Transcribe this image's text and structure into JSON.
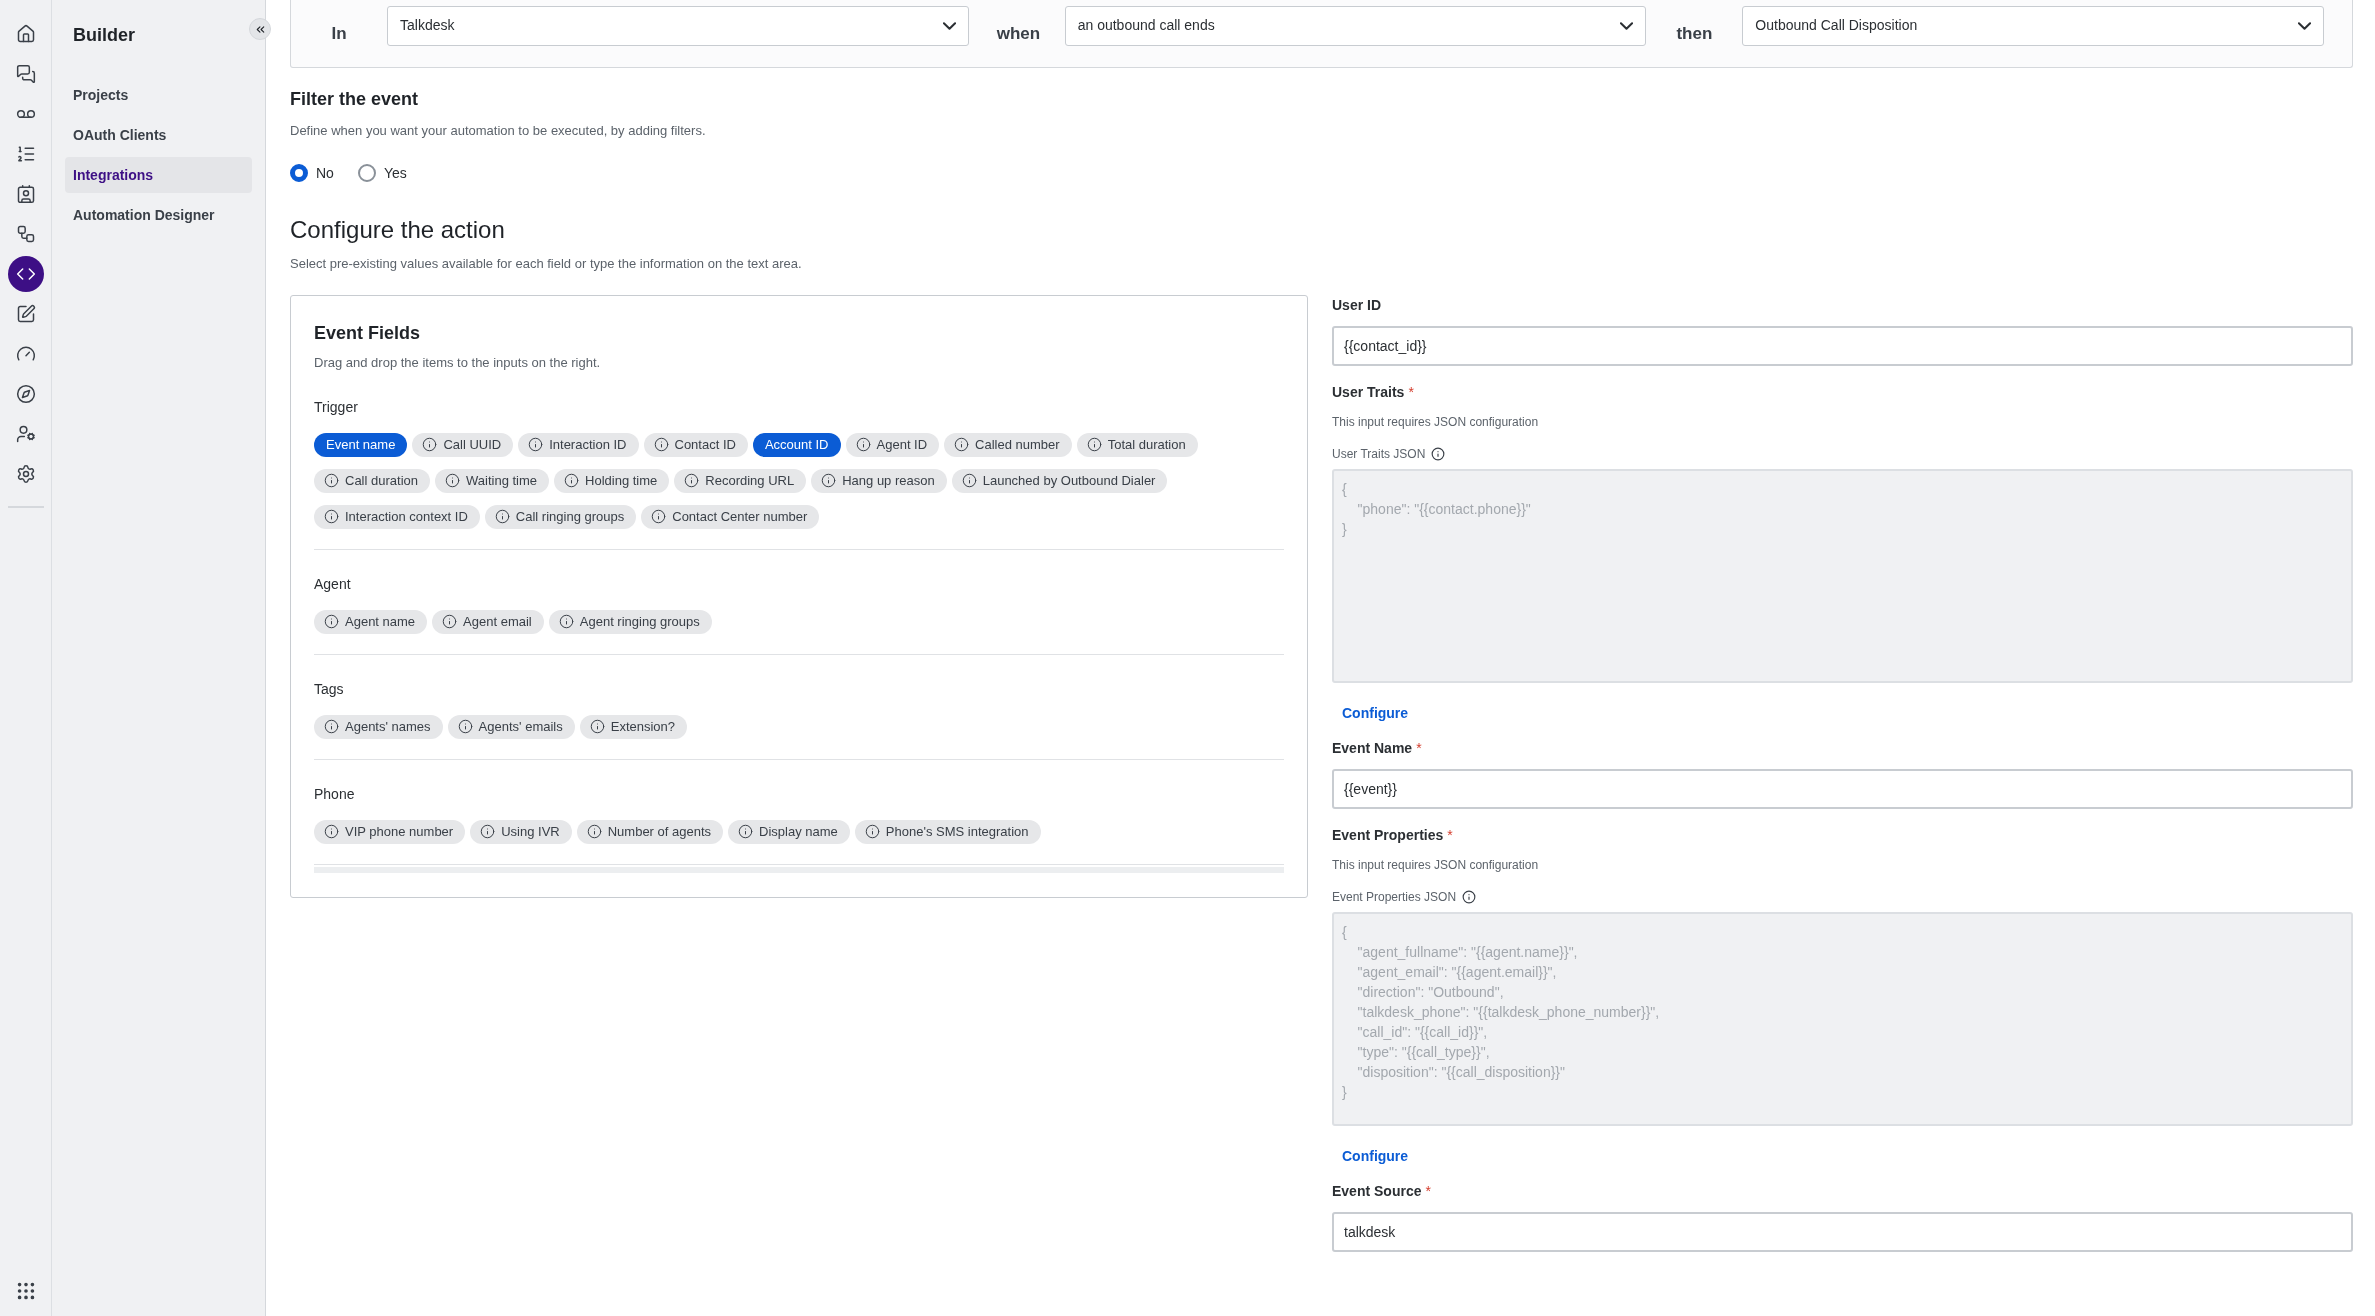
{
  "rail": {
    "items": [
      {
        "selected": false
      },
      {
        "selected": false
      },
      {
        "selected": false
      },
      {
        "selected": false
      },
      {
        "selected": false
      },
      {
        "selected": false
      },
      {
        "selected": true
      },
      {
        "selected": false
      },
      {
        "selected": false
      },
      {
        "selected": false
      },
      {
        "selected": false
      },
      {
        "selected": false
      }
    ]
  },
  "sidebar": {
    "title": "Builder",
    "items": [
      {
        "label": "Projects",
        "selected": false
      },
      {
        "label": "OAuth Clients",
        "selected": false
      },
      {
        "label": "Integrations",
        "selected": true
      },
      {
        "label": "Automation Designer",
        "selected": false
      }
    ]
  },
  "trigger_bar": {
    "parts": [
      {
        "label": "In",
        "value": "Talkdesk"
      },
      {
        "label": "when",
        "value": "an outbound call ends"
      },
      {
        "label": "then",
        "value": "Outbound Call Disposition"
      }
    ]
  },
  "filter": {
    "title": "Filter the event",
    "description": "Define when you want your automation to be executed, by adding filters.",
    "options": [
      {
        "label": "No",
        "selected": true
      },
      {
        "label": "Yes",
        "selected": false
      }
    ]
  },
  "configure": {
    "title": "Configure the action",
    "description": "Select pre-existing values available for each field or type the information on the text area."
  },
  "event_fields": {
    "title": "Event Fields",
    "description": "Drag and drop the items to the inputs on the right.",
    "groups": [
      {
        "title": "Trigger",
        "chips": [
          {
            "label": "Event name",
            "selected": true
          },
          {
            "label": "Call UUID",
            "selected": false
          },
          {
            "label": "Interaction ID",
            "selected": false
          },
          {
            "label": "Contact ID",
            "selected": false
          },
          {
            "label": "Account ID",
            "selected": true
          },
          {
            "label": "Agent ID",
            "selected": false
          },
          {
            "label": "Called number",
            "selected": false
          },
          {
            "label": "Total duration",
            "selected": false
          },
          {
            "label": "Call duration",
            "selected": false
          },
          {
            "label": "Waiting time",
            "selected": false
          },
          {
            "label": "Holding time",
            "selected": false
          },
          {
            "label": "Recording URL",
            "selected": false
          },
          {
            "label": "Hang up reason",
            "selected": false
          },
          {
            "label": "Launched by Outbound Dialer",
            "selected": false
          },
          {
            "label": "Interaction context ID",
            "selected": false
          },
          {
            "label": "Call ringing groups",
            "selected": false
          },
          {
            "label": "Contact Center number",
            "selected": false
          }
        ]
      },
      {
        "title": "Agent",
        "chips": [
          {
            "label": "Agent name",
            "selected": false
          },
          {
            "label": "Agent email",
            "selected": false
          },
          {
            "label": "Agent ringing groups",
            "selected": false
          }
        ]
      },
      {
        "title": "Tags",
        "chips": [
          {
            "label": "Agents' names",
            "selected": false
          },
          {
            "label": "Agents' emails",
            "selected": false
          },
          {
            "label": "Extension?",
            "selected": false
          }
        ]
      },
      {
        "title": "Phone",
        "chips": [
          {
            "label": "VIP phone number",
            "selected": false
          },
          {
            "label": "Using IVR",
            "selected": false
          },
          {
            "label": "Number of agents",
            "selected": false
          },
          {
            "label": "Display name",
            "selected": false
          },
          {
            "label": "Phone's SMS integration",
            "selected": false
          }
        ]
      }
    ]
  },
  "fields": [
    {
      "kind": "input",
      "label": "User ID",
      "value": "{{contact_id}}"
    },
    {
      "kind": "json",
      "label": "User Traits",
      "required_mark": "*",
      "hint": "This input requires JSON configuration",
      "json_label": "User Traits JSON",
      "placeholder": "{\n    \"phone\": \"{{contact.phone}}\"\n}",
      "action": "Configure"
    },
    {
      "kind": "input",
      "label": "Event Name",
      "required_mark": "*",
      "value": "{{event}}"
    },
    {
      "kind": "json",
      "label": "Event Properties",
      "required_mark": "*",
      "hint": "This input requires JSON configuration",
      "json_label": "Event Properties JSON",
      "placeholder": "{\n    \"agent_fullname\": \"{{agent.name}}\",\n    \"agent_email\": \"{{agent.email}}\",\n    \"direction\": \"Outbound\",\n    \"talkdesk_phone\": \"{{talkdesk_phone_number}}\",\n    \"call_id\": \"{{call_id}}\",\n    \"type\": \"{{call_type}}\",\n    \"disposition\": \"{{call_disposition}}\"\n}",
      "action": "Configure"
    },
    {
      "kind": "input",
      "label": "Event Source",
      "required_mark": "*",
      "value": "talkdesk"
    }
  ]
}
